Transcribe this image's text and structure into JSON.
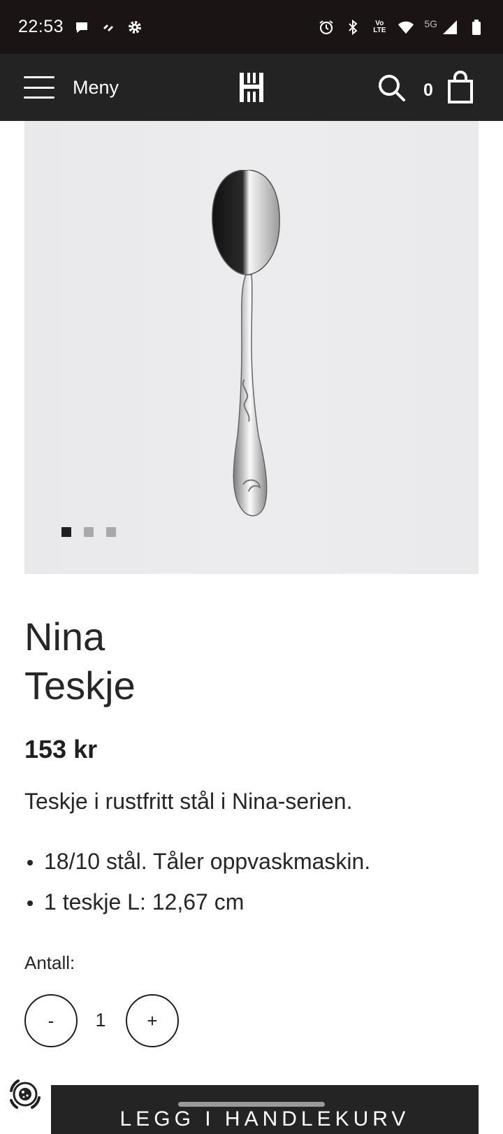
{
  "status_bar": {
    "time": "22:53",
    "network_label": "5G",
    "volte_top": "Vo",
    "volte_bottom": "LTE",
    "icons": [
      "chat-notification-icon",
      "app-notification-icon",
      "settings-icon",
      "alarm-icon",
      "bluetooth-icon",
      "volte-icon",
      "wifi-icon",
      "cellular-signal-icon",
      "battery-icon"
    ]
  },
  "header": {
    "menu_label": "Meny",
    "cart_count": "0",
    "icons": [
      "hamburger-icon",
      "logo",
      "search-icon",
      "shopping-bag-icon"
    ]
  },
  "gallery": {
    "image_alt": "spoon",
    "slide_count": 3,
    "active_slide": 1
  },
  "product": {
    "title_line1": "Nina",
    "title_line2": "Teskje",
    "price": "153 kr",
    "description": "Teskje i rustfritt stål i Nina-serien.",
    "features": [
      "18/10 stål. Tåler oppvaskmaskin.",
      "1 teskje L: 12,67 cm"
    ]
  },
  "quantity": {
    "label": "Antall:",
    "minus_label": "-",
    "value": "1",
    "plus_label": "+"
  },
  "cta": {
    "add_to_cart_label": "LEGG I HANDLEKURV"
  },
  "colors": {
    "header_bg": "#232323",
    "status_bg": "#1b1414",
    "button_bg": "#242424",
    "gallery_bg": "#ebeaec"
  }
}
